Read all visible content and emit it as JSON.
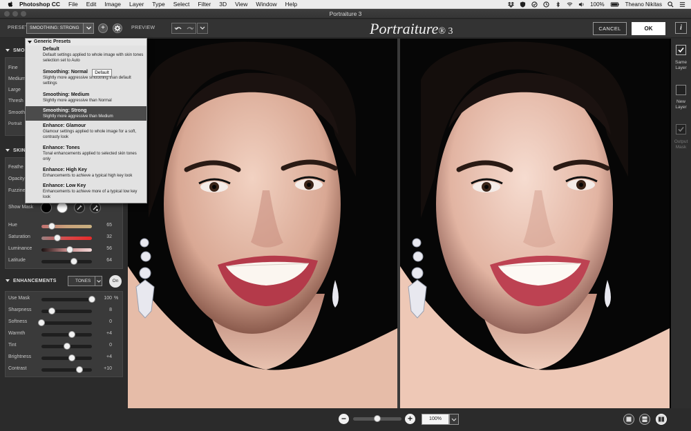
{
  "menubar": {
    "app_name": "Photoshop CC",
    "items": [
      "File",
      "Edit",
      "Image",
      "Layer",
      "Type",
      "Select",
      "Filter",
      "3D",
      "View",
      "Window",
      "Help"
    ],
    "battery": "100%",
    "user": "Theano Nikitas"
  },
  "window": {
    "title": "Portraiture 3"
  },
  "toolbar": {
    "preset_label": "PRESET",
    "preset_value": "SMOOTHING: STRONG",
    "preview_label": "PREVIEW",
    "logo_text": "Portraiture",
    "logo_mark": "® 3",
    "cancel_label": "CANCEL",
    "ok_label": "OK",
    "info_label": "i"
  },
  "sections": {
    "smoothing": {
      "header": "SMOO",
      "rows": [
        "Fine",
        "Medium",
        "Large",
        "Thresh",
        "Smooth",
        "Portrait"
      ]
    },
    "skin": {
      "header": "SKIN",
      "rows_partial": [
        "Feathe",
        "Opacity",
        "Fuzzine"
      ],
      "show_mask_label": "Show Mask",
      "sliders": [
        {
          "label": "Hue",
          "value": "65",
          "level": 0.2
        },
        {
          "label": "Saturation",
          "value": "32",
          "level": 0.32
        },
        {
          "label": "Luminance",
          "value": "56",
          "level": 0.56
        },
        {
          "label": "Latitude",
          "value": "64",
          "level": 0.64
        }
      ]
    },
    "enhancements": {
      "header": "ENHANCEMENTS",
      "mode_select": "TONES",
      "on_label": "On",
      "sliders": [
        {
          "label": "Use Mask",
          "value": "100",
          "unit": "%",
          "level": 1.0
        },
        {
          "label": "Sharpness",
          "value": "8",
          "unit": "",
          "level": 0.2
        },
        {
          "label": "Softness",
          "value": "0",
          "unit": "",
          "level": 0.0
        },
        {
          "label": "Warmth",
          "value": "+4",
          "unit": "",
          "level": 0.6
        },
        {
          "label": "Tint",
          "value": "0",
          "unit": "",
          "level": 0.5
        },
        {
          "label": "Brightness",
          "value": "+4",
          "unit": "",
          "level": 0.6
        },
        {
          "label": "Contrast",
          "value": "+10",
          "unit": "",
          "level": 0.75
        }
      ]
    }
  },
  "preset_dropdown": {
    "group_label": "Generic Presets",
    "tooltip": "Default",
    "items": [
      {
        "title": "Default",
        "desc": "Default settings applied to whole image with skin tones selection set to Auto"
      },
      {
        "title": "Smoothing: Normal",
        "desc": "Slightly more aggressive smoothing than default settings"
      },
      {
        "title": "Smoothing: Medium",
        "desc": "Slightly more aggressive than Normal"
      },
      {
        "title": "Smoothing: Strong",
        "desc": "Slightly more aggressive than Medium"
      },
      {
        "title": "Enhance: Glamour",
        "desc": "Glamour settings applied to whole image for a soft, contrasty look"
      },
      {
        "title": "Enhance: Tones",
        "desc": "Tonal enhancements applied to selected skin tones only"
      },
      {
        "title": "Enhance: High Key",
        "desc": "Enhancements to achieve a typical high key look"
      },
      {
        "title": "Enhance: Low Key",
        "desc": "Enhancements to achieve more of a typical low key look"
      }
    ],
    "selected_index": 3
  },
  "right_panel": {
    "same_layer": "Same Layer",
    "new_layer": "New Layer",
    "output_mask": "Output Mask"
  },
  "bottom": {
    "zoom_out": "−",
    "zoom_in": "+",
    "zoom_value": "100%",
    "zoom_level": 0.5
  },
  "colors": {
    "panel_bg": "#2b2b2b",
    "section_bg": "#3a3a3a",
    "hue_track": "#c9a27a",
    "saturation_track": "#d84848",
    "luminance_track": "#c88a8a"
  }
}
